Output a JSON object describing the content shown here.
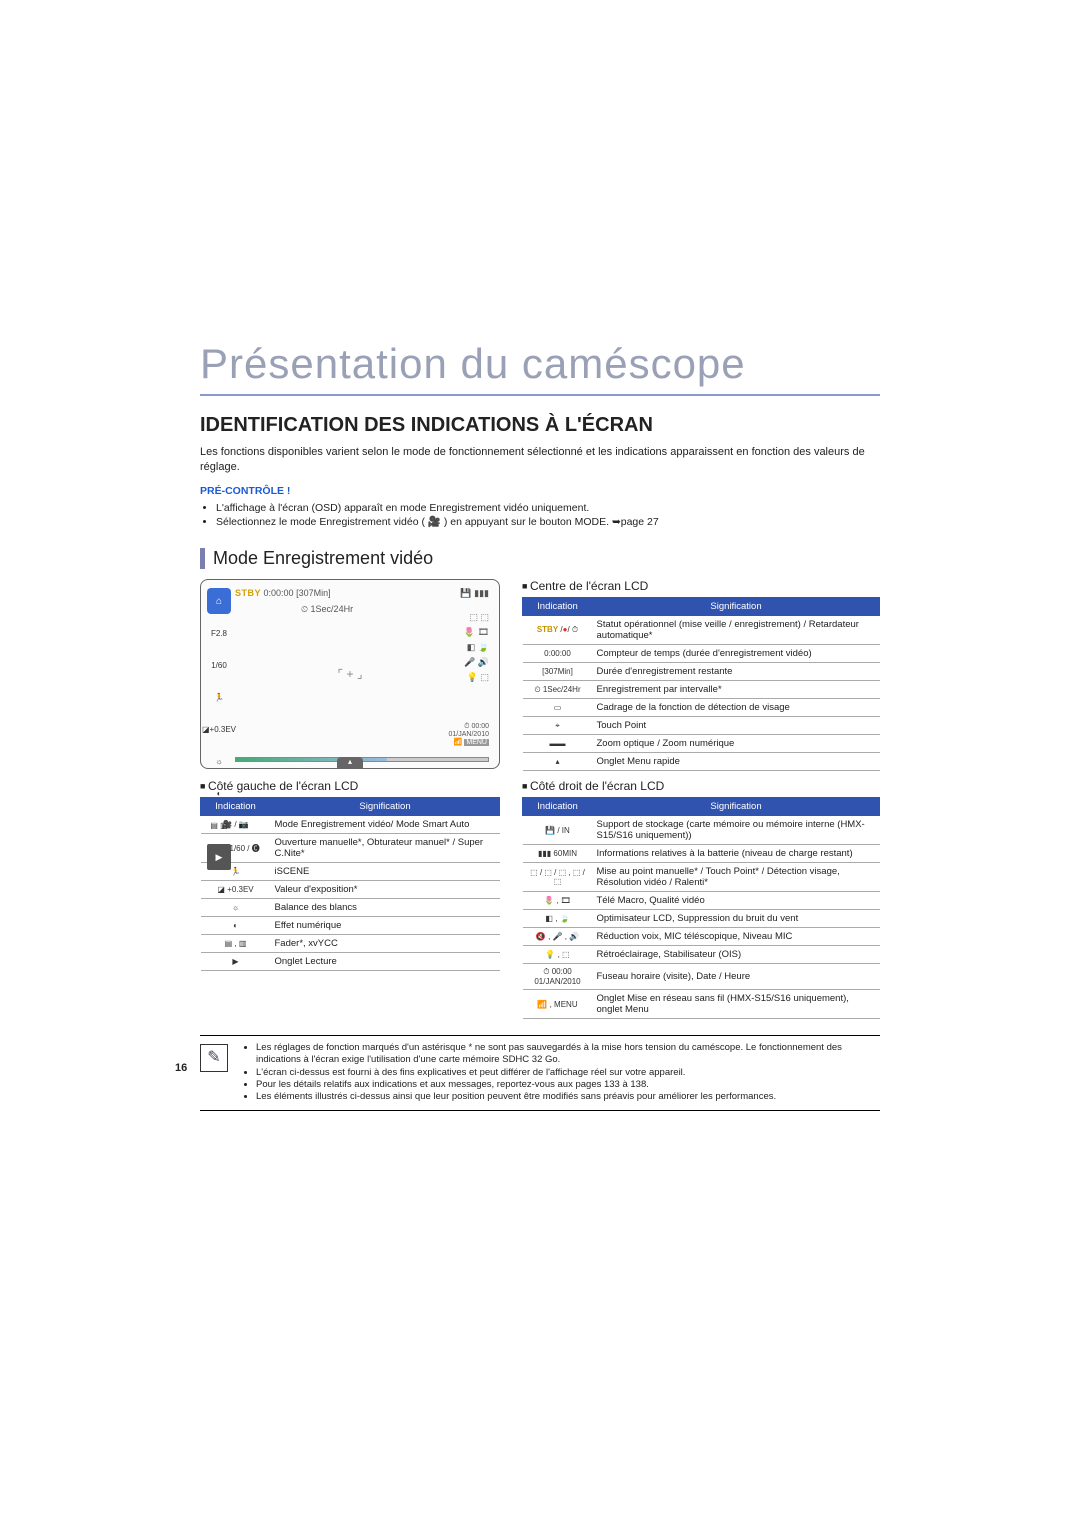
{
  "page_number": "16",
  "title": "Présentation du caméscope",
  "h2": "IDENTIFICATION DES INDICATIONS À L'ÉCRAN",
  "intro": "Les fonctions disponibles varient selon le mode de fonctionnement sélectionné et les indications apparaissent en fonction des valeurs de réglage.",
  "pre_title": "PRÉ-CONTRÔLE !",
  "pre_items": [
    "L'affichage à l'écran (OSD) apparaît en mode Enregistrement vidéo uniquement.",
    "Sélectionnez le mode Enregistrement vidéo ( 🎥 ) en appuyant sur le bouton MODE. ➥page 27"
  ],
  "h3": "Mode Enregistrement vidéo",
  "lcd": {
    "stby": "STBY",
    "counter": "0:00:00",
    "remain": "[307Min]",
    "interval": "1Sec/24Hr",
    "ev": "+0.3EV",
    "ap": "F2.8",
    "shut": "1/60",
    "menu_time": "00:00",
    "menu_date": "01/JAN/2010",
    "menu_label": "MENU"
  },
  "center_label": "Centre de l'écran LCD",
  "left_label": "Côté gauche de l'écran LCD",
  "right_label": "Côté droit de l'écran LCD",
  "th_ind": "Indication",
  "th_sig": "Signification",
  "center_rows": [
    {
      "ind": "STBY / ● / ⏱",
      "sig": "Statut opérationnel (mise veille / enregistrement) / Retardateur automatique*"
    },
    {
      "ind": "0:00:00",
      "sig": "Compteur de temps (durée d'enregistrement vidéo)"
    },
    {
      "ind": "[307Min]",
      "sig": "Durée d'enregistrement restante"
    },
    {
      "ind": "⏲ 1Sec/24Hr",
      "sig": "Enregistrement par intervalle*"
    },
    {
      "ind": "▭",
      "sig": "Cadrage de la fonction de détection de visage"
    },
    {
      "ind": "⌖",
      "sig": "Touch Point"
    },
    {
      "ind": "▬▬",
      "sig": "Zoom optique / Zoom numérique"
    },
    {
      "ind": "▴",
      "sig": "Onglet Menu rapide"
    }
  ],
  "left_rows": [
    {
      "ind": "🎥 / 📷",
      "sig": "Mode Enregistrement vidéo/ Mode Smart Auto"
    },
    {
      "ind": "F2.8 1/60 / 🅒",
      "sig": "Ouverture manuelle*, Obturateur manuel* / Super C.Nite*"
    },
    {
      "ind": "🏃",
      "sig": "iSCENE"
    },
    {
      "ind": "◪ +0.3EV",
      "sig": "Valeur d'exposition*"
    },
    {
      "ind": "☼",
      "sig": "Balance des blancs"
    },
    {
      "ind": "◐",
      "sig": "Effet numérique"
    },
    {
      "ind": "▤ , ▥",
      "sig": "Fader*, xvYCC"
    },
    {
      "ind": "▶",
      "sig": "Onglet Lecture"
    }
  ],
  "right_rows": [
    {
      "ind": "💾 / IN",
      "sig": "Support de stockage (carte mémoire ou mémoire interne (HMX-S15/S16 uniquement))"
    },
    {
      "ind": "▮▮▮ 60MIN",
      "sig": "Informations relatives à la batterie (niveau de charge restant)"
    },
    {
      "ind": "⬚ / ⬚ / ⬚ , ⬚ / ⬚",
      "sig": "Mise au point manuelle* / Touch Point* / Détection visage, Résolution vidéo / Ralenti*"
    },
    {
      "ind": "🌷 , 🎞",
      "sig": "Télé Macro, Qualité vidéo"
    },
    {
      "ind": "◧ , 🍃",
      "sig": "Optimisateur LCD, Suppression du bruit du vent"
    },
    {
      "ind": "🔇 , 🎤 , 🔊",
      "sig": "Réduction voix, MIC téléscopique, Niveau MIC"
    },
    {
      "ind": "💡 , ⬚",
      "sig": "Rétroéclairage, Stabilisateur (OIS)"
    },
    {
      "ind": "⏱ 00:00 01/JAN/2010",
      "sig": "Fuseau horaire (visite), Date / Heure"
    },
    {
      "ind": "📶 , MENU",
      "sig": "Onglet Mise en réseau sans fil (HMX-S15/S16 uniquement), onglet Menu"
    }
  ],
  "notes": [
    "Les réglages de fonction marqués d'un astérisque * ne sont pas sauvegardés à la mise hors tension du caméscope. Le fonctionnement des indications à l'écran exige l'utilisation d'une carte mémoire SDHC 32 Go.",
    "L'écran ci-dessus est fourni à des fins explicatives et peut différer de l'affichage réel sur votre appareil.",
    "Pour les détails relatifs aux indications et aux messages, reportez-vous aux pages 133 à 138.",
    "Les éléments illustrés ci-dessus ainsi que leur position peuvent être modifiés sans préavis pour améliorer les performances."
  ]
}
